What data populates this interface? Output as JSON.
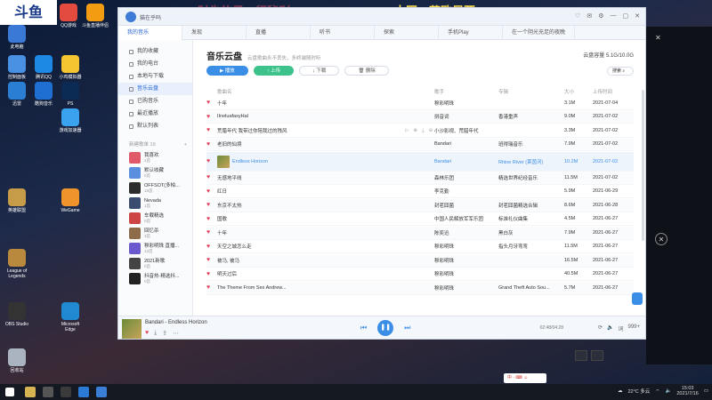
{
  "stream": {
    "banner": "斗鱼",
    "left_text": "财先的子，行秘吖",
    "right_text": "大区：艾欧尼亚"
  },
  "desktop_icons": [
    {
      "label": "此电脑",
      "color": "#3b79d6"
    },
    {
      "label": "QQ游戏",
      "color": "#e34b3f"
    },
    {
      "label": "斗鱼直播伴侣",
      "color": "#f39c12"
    },
    {
      "label": "控制面板",
      "color": "#4a90e2"
    },
    {
      "label": "腾讯QQ",
      "color": "#1e88e5"
    },
    {
      "label": "小鸡模拟器",
      "color": "#f5c531"
    },
    {
      "label": "迅雷",
      "color": "#2a7fd4"
    },
    {
      "label": "酷狗音乐",
      "color": "#1f6fd3"
    },
    {
      "label": "PS",
      "color": "#0b2b55"
    },
    {
      "label": "游戏加速器",
      "color": "#3aa3f0"
    },
    {
      "label": "英雄联盟",
      "color": "#c69c48"
    },
    {
      "label": "WeGame",
      "color": "#f0932b"
    },
    {
      "label": "League of Legends",
      "color": "#b98a3e"
    },
    {
      "label": "OBS Studio",
      "color": "#333"
    },
    {
      "label": "回收站",
      "color": "#aab4c0"
    },
    {
      "label": "Microsoft Edge",
      "color": "#1f8ad2"
    }
  ],
  "app": {
    "username": "猫在乎吗",
    "window_controls": [
      "♡",
      "✉",
      "⚙",
      "—",
      "▢",
      "✕"
    ],
    "tabs": [
      {
        "label": "我的音乐",
        "active": true
      },
      {
        "label": "发现"
      },
      {
        "label": "直播"
      },
      {
        "label": "听书"
      },
      {
        "label": "探索"
      },
      {
        "label": "手机Play"
      },
      {
        "label": "在一个阴光充足的夜晚"
      }
    ],
    "sidebar": {
      "items": [
        {
          "label": "我的收藏"
        },
        {
          "label": "我的电台"
        },
        {
          "label": "本地与下载"
        },
        {
          "label": "音乐云盘",
          "active": true
        },
        {
          "label": "已购音乐"
        },
        {
          "label": "最近播放"
        },
        {
          "label": "默认列表"
        }
      ],
      "playlist_header": "新建歌单",
      "playlist_count": "19",
      "playlists": [
        {
          "title": "我喜欢",
          "sub": "1首",
          "color": "#e05a6a"
        },
        {
          "title": "默认收藏",
          "sub": "0首",
          "color": "#5a8fe0"
        },
        {
          "title": "OFFSOT(多柏...",
          "sub": "18首",
          "color": "#2d2d2d"
        },
        {
          "title": "Nevada",
          "sub": "1首",
          "color": "#3b4d6e"
        },
        {
          "title": "车载精选",
          "sub": "0首",
          "color": "#c44"
        },
        {
          "title": "回忆杀",
          "sub": "3首",
          "color": "#8e6c4a"
        },
        {
          "title": "穆彩明珠 直播...",
          "sub": "13首",
          "color": "#6a5acd"
        },
        {
          "title": "2021新歌",
          "sub": "0首",
          "color": "#444"
        },
        {
          "title": "抖音热·精选抖...",
          "sub": "0首",
          "color": "#222"
        }
      ]
    },
    "main": {
      "title": "音乐云盘",
      "subtitle": "云盘歌曲永不丢失，多终端随时听",
      "capacity_label": "云盘容量",
      "capacity": "5.1G/10.0G",
      "buttons": {
        "play": "播放",
        "upload": "上传",
        "download": "下载",
        "delete": "删除"
      },
      "sort": "搜索",
      "columns": {
        "name": "歌曲名",
        "artist": "歌手",
        "album": "专辑",
        "size": "大小",
        "time": "上传时间"
      },
      "rows": [
        {
          "name": "十年",
          "artist": "穆彩明珠",
          "album": "",
          "size": "3.1M",
          "time": "2021-07-04"
        },
        {
          "name": "⁠IIneluafasyHal",
          "artist": "拼音词",
          "album": "香港重声",
          "size": "9.0M",
          "time": "2021-07-02"
        },
        {
          "name": "荒腊年代 我带过你陪我过的残风",
          "artist": "小沙影视、荒腊年代",
          "album": "",
          "size": "3.3M",
          "time": "2021-07-02"
        },
        {
          "name": "老旧的仙境",
          "artist": "Bandari",
          "album": "班得瑞音乐",
          "size": "7.9M",
          "time": "2021-07-02"
        },
        {
          "name": "Endless Horizon",
          "artist": "Bandari",
          "album": "Rhine River (莱茵河)",
          "size": "10.2M",
          "time": "2021-07-02",
          "selected": true
        },
        {
          "name": "无感地平线",
          "artist": "森林乐团",
          "album": "精选世界纪经音乐",
          "size": "11.5M",
          "time": "2021-07-02"
        },
        {
          "name": "红日",
          "artist": "李克勤",
          "album": "",
          "size": "5.9M",
          "time": "2021-06-29"
        },
        {
          "name": "东京不太热",
          "artist": "封茗囧菌",
          "album": "封茗囧菌精选合辑",
          "size": "8.6M",
          "time": "2021-06-28"
        },
        {
          "name": "国歌",
          "artist": "中国人民解放军军乐团",
          "album": "标准礼仪曲集",
          "size": "4.5M",
          "time": "2021-06-27"
        },
        {
          "name": "十年",
          "artist": "陈奕迅",
          "album": "黑白灰",
          "size": "7.9M",
          "time": "2021-06-27"
        },
        {
          "name": "天空之城怎么走",
          "artist": "穆彩明珠",
          "album": "指头月牙弯弯",
          "size": "11.5M",
          "time": "2021-06-27"
        },
        {
          "name": "被马, 被马",
          "artist": "穆彩明珠",
          "album": "",
          "size": "16.5M",
          "time": "2021-06-27"
        },
        {
          "name": "明天过后",
          "artist": "穆彩明珠",
          "album": "",
          "size": "40.5M",
          "time": "2021-06-27"
        },
        {
          "name": "The Theme From Sex Andrew...",
          "artist": "穆彩明珠",
          "album": "Grand Theft Auto Sou...",
          "size": "5.7M",
          "time": "2021-06-27"
        }
      ]
    },
    "player": {
      "now_playing": "Bandari - Endless Horizon",
      "elapsed": "02:48/04:28",
      "quality": "999+"
    }
  },
  "taskbar": {
    "weather": "22°C 多云",
    "time": "15:03",
    "date": "2021/7/16",
    "ime": "中"
  }
}
